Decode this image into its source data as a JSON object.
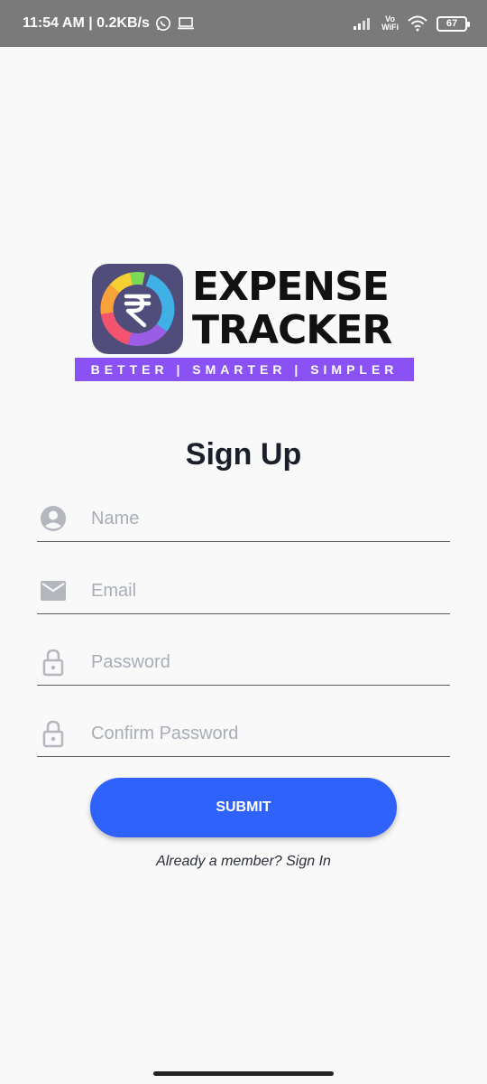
{
  "status_bar": {
    "time_speed": "11:54 AM | 0.2KB/s",
    "vowifi_top": "Vo",
    "vowifi_bottom": "WiFi",
    "battery": "67"
  },
  "logo": {
    "line1": "EXPENSE",
    "line2": "TRACKER",
    "tagline": "BETTER | SMARTER | SIMPLER",
    "icon": "rupee-donut-icon"
  },
  "form": {
    "title": "Sign Up",
    "fields": [
      {
        "placeholder": "Name",
        "value": "",
        "icon": "account-circle-icon"
      },
      {
        "placeholder": "Email",
        "value": "",
        "icon": "mail-icon"
      },
      {
        "placeholder": "Password",
        "value": "",
        "icon": "lock-icon"
      },
      {
        "placeholder": "Confirm Password",
        "value": "",
        "icon": "lock-icon"
      }
    ],
    "submit_label": "SUBMIT",
    "signin_text": "Already a member? Sign In"
  },
  "colors": {
    "accent": "#2f62fa",
    "tagline_bg": "#8a52f5",
    "status_bar_bg": "#7a7a7a"
  }
}
